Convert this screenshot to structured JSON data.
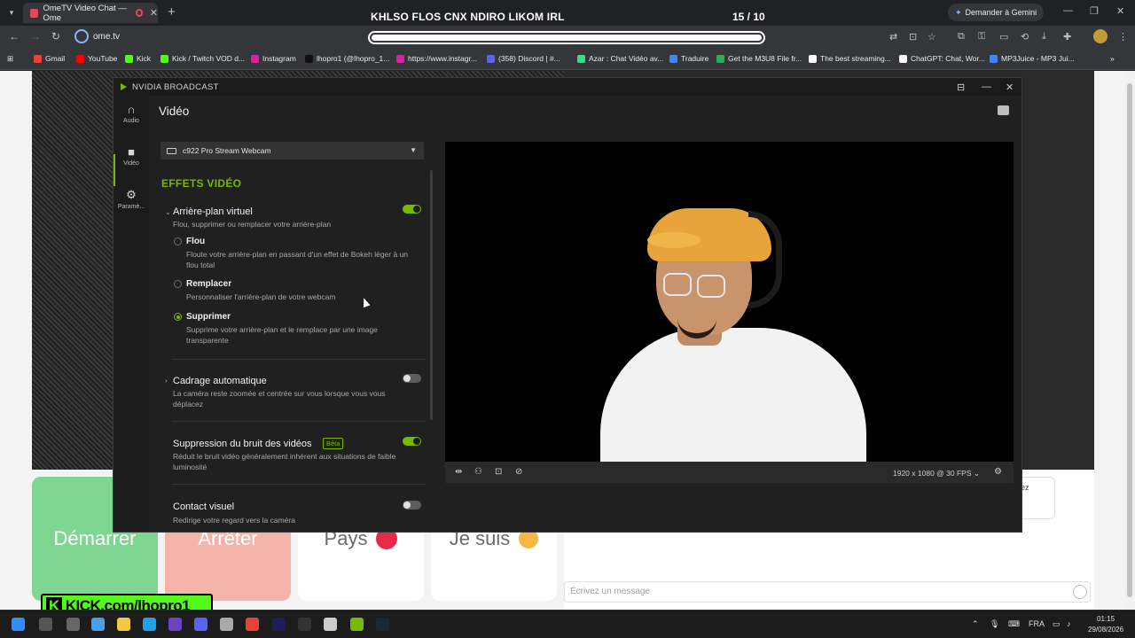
{
  "browser": {
    "tab_title": "OmeTV Video Chat — Ome",
    "gemini_label": "Demander à Gemini",
    "url": "ome.tv",
    "bookmarks": [
      {
        "label": "Gmail",
        "color": "#ea4335"
      },
      {
        "label": "YouTube",
        "color": "#ff0000"
      },
      {
        "label": "Kick",
        "color": "#53fc18"
      },
      {
        "label": "Kick / Twitch VOD d...",
        "color": "#53fc18"
      },
      {
        "label": "Instagram",
        "color": "#d6249f"
      },
      {
        "label": "lhopro1 (@lhopro_1...",
        "color": "#111111"
      },
      {
        "label": "https://www.instagr...",
        "color": "#d6249f"
      },
      {
        "label": "(358) Discord | #...",
        "color": "#5865f2"
      },
      {
        "label": "Azar : Chat Vidéo av...",
        "color": "#3ddc84"
      },
      {
        "label": "Traduire",
        "color": "#4285f4"
      },
      {
        "label": "Get the M3U8 File fr...",
        "color": "#34a853"
      },
      {
        "label": "The best streaming...",
        "color": "#ffffff"
      },
      {
        "label": "ChatGPT: Chat, Wor...",
        "color": "#ffffff"
      },
      {
        "label": "MP3Juice - MP3 Jui...",
        "color": "#4285f4"
      }
    ]
  },
  "stream_overlay": {
    "title": "KHLSO FLOS CNX NDIRO LIKOM IRL",
    "count": "15 / 10",
    "progress_fraction": 1.0
  },
  "nvidia": {
    "window_title": "NVIDIA BROADCAST",
    "sidebar": [
      {
        "label": "Audio",
        "icon": "headphones-icon"
      },
      {
        "label": "Vidéo",
        "icon": "camera-icon"
      },
      {
        "label": "Paramè...",
        "icon": "gear-icon"
      }
    ],
    "heading": "Vidéo",
    "camera_select": "c922 Pro Stream Webcam",
    "section_title": "EFFETS VIDÉO",
    "virtual_bg": {
      "title": "Arrière-plan virtuel",
      "desc": "Flou, supprimer ou remplacer votre arrière-plan",
      "enabled": true,
      "options": [
        {
          "title": "Flou",
          "desc": "Floute votre arrière-plan en passant d'un effet de Bokeh léger à un flou total",
          "selected": false
        },
        {
          "title": "Remplacer",
          "desc": "Personnaliser l'arrière-plan de votre webcam",
          "selected": false
        },
        {
          "title": "Supprimer",
          "desc": "Supprime votre arrière-plan et le remplace par une image transparente",
          "selected": true
        }
      ]
    },
    "auto_frame": {
      "title": "Cadrage automatique",
      "desc": "La caméra reste zoomée et centrée sur vous lorsque vous vous déplacez",
      "enabled": false
    },
    "noise": {
      "title": "Suppression du bruit des vidéos",
      "badge": "Bêta",
      "desc": "Réduit le bruit vidéo généralement inhérent aux situations de faible luminosité",
      "enabled": true
    },
    "eye_contact": {
      "title": "Contact visuel",
      "desc": "Redirige votre regard vers la caméra",
      "enabled": false
    },
    "resolution": "1920 x 1080 @ 30 FPS"
  },
  "ometv": {
    "start": "Démarrer",
    "stop": "Arrêter",
    "country": "Pays",
    "iam": "Je suis",
    "chat_placeholder": "Écrivez un message",
    "tooltip_fragment": "ez"
  },
  "overlay": {
    "kick_text": "KICK.com/lhopro1"
  },
  "taskbar": {
    "lang": "FRA",
    "time": "01:15",
    "date": "29/08/2026"
  }
}
